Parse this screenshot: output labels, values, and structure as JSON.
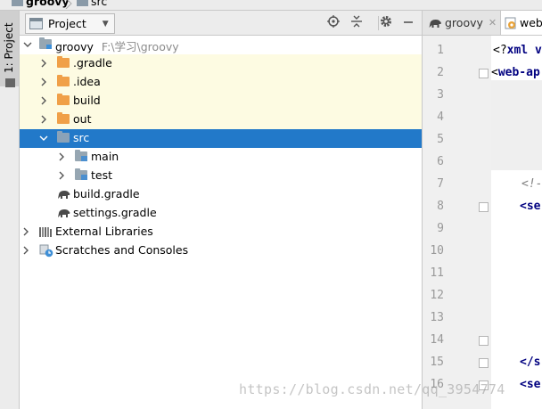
{
  "breadcrumb": {
    "items": [
      "groovy",
      "src"
    ]
  },
  "tool_stripe": {
    "tab_label": "1: Project"
  },
  "project_panel": {
    "title": "Project",
    "tree": [
      {
        "label": "groovy",
        "path": "F:\\学习\\groovy",
        "icon": "module-folder-icon",
        "expanded": true,
        "level": 0
      },
      {
        "label": ".gradle",
        "icon": "excluded-folder-icon",
        "expanded": false,
        "level": 1
      },
      {
        "label": ".idea",
        "icon": "excluded-folder-icon",
        "expanded": false,
        "level": 1
      },
      {
        "label": "build",
        "icon": "excluded-folder-icon",
        "expanded": false,
        "level": 1
      },
      {
        "label": "out",
        "icon": "excluded-folder-icon",
        "expanded": false,
        "level": 1
      },
      {
        "label": "src",
        "icon": "folder-icon",
        "expanded": true,
        "selected": true,
        "level": 1
      },
      {
        "label": "main",
        "icon": "source-folder-icon",
        "expanded": false,
        "level": 2
      },
      {
        "label": "test",
        "icon": "source-folder-icon",
        "expanded": false,
        "level": 2
      },
      {
        "label": "build.gradle",
        "icon": "gradle-icon",
        "level": 1
      },
      {
        "label": "settings.gradle",
        "icon": "gradle-icon",
        "level": 1
      },
      {
        "label": "External Libraries",
        "icon": "libraries-icon",
        "expanded": false,
        "level": 0
      },
      {
        "label": "Scratches and Consoles",
        "icon": "scratches-icon",
        "expanded": false,
        "level": 0
      }
    ]
  },
  "editor": {
    "tabs": [
      {
        "label": "groovy",
        "active": false
      },
      {
        "label": "web",
        "active": true
      }
    ],
    "line_numbers": [
      "1",
      "2",
      "3",
      "4",
      "5",
      "6",
      "7",
      "8",
      "9",
      "10",
      "11",
      "12",
      "13",
      "14",
      "15",
      "16"
    ],
    "code_fragments": {
      "l1_prefix": "<?",
      "l1_keyword": "xml v",
      "l2_prefix": "<",
      "l2_keyword": "web-ap",
      "l7": "<!-",
      "l8": "<se",
      "l15": "</s",
      "l16": "<se"
    }
  },
  "watermark": "https://blog.csdn.net/qq_3954774",
  "colors": {
    "selection": "#2279c9",
    "excluded_highlight": "#fdfbe2",
    "keyword": "#000080"
  }
}
